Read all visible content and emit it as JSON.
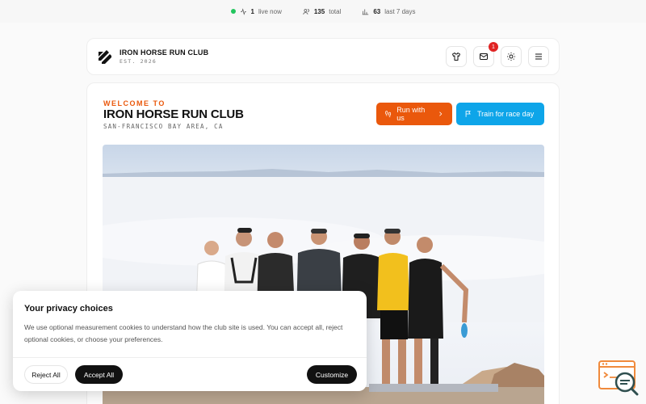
{
  "stats": {
    "live_count": "1",
    "live_label": "live now",
    "total_count": "135",
    "total_label": "total",
    "week_count": "63",
    "week_label": "last 7 days"
  },
  "header": {
    "brand_name": "IRON HORSE RUN CLUB",
    "brand_est": "EST. 2026",
    "notification_count": "1",
    "icons": [
      "shirt-icon",
      "mail-icon",
      "sun-icon",
      "menu-icon"
    ]
  },
  "hero": {
    "welcome": "WELCOME TO",
    "title": "IRON HORSE RUN CLUB",
    "location": "SAN-FRANCISCO BAY AREA, CA",
    "run_button": "Run with us",
    "train_button": "Train for race day"
  },
  "privacy": {
    "title": "Your privacy choices",
    "body": "We use optional measurement cookies to understand how the club site is used. You can accept all, reject optional cookies, or choose your preferences.",
    "reject": "Reject All",
    "accept": "Accept All",
    "customize": "Customize"
  },
  "colors": {
    "orange": "#ea580c",
    "sky": "#0ea5e9",
    "dark": "#111111",
    "live": "#22c55e",
    "badge": "#e02424"
  }
}
